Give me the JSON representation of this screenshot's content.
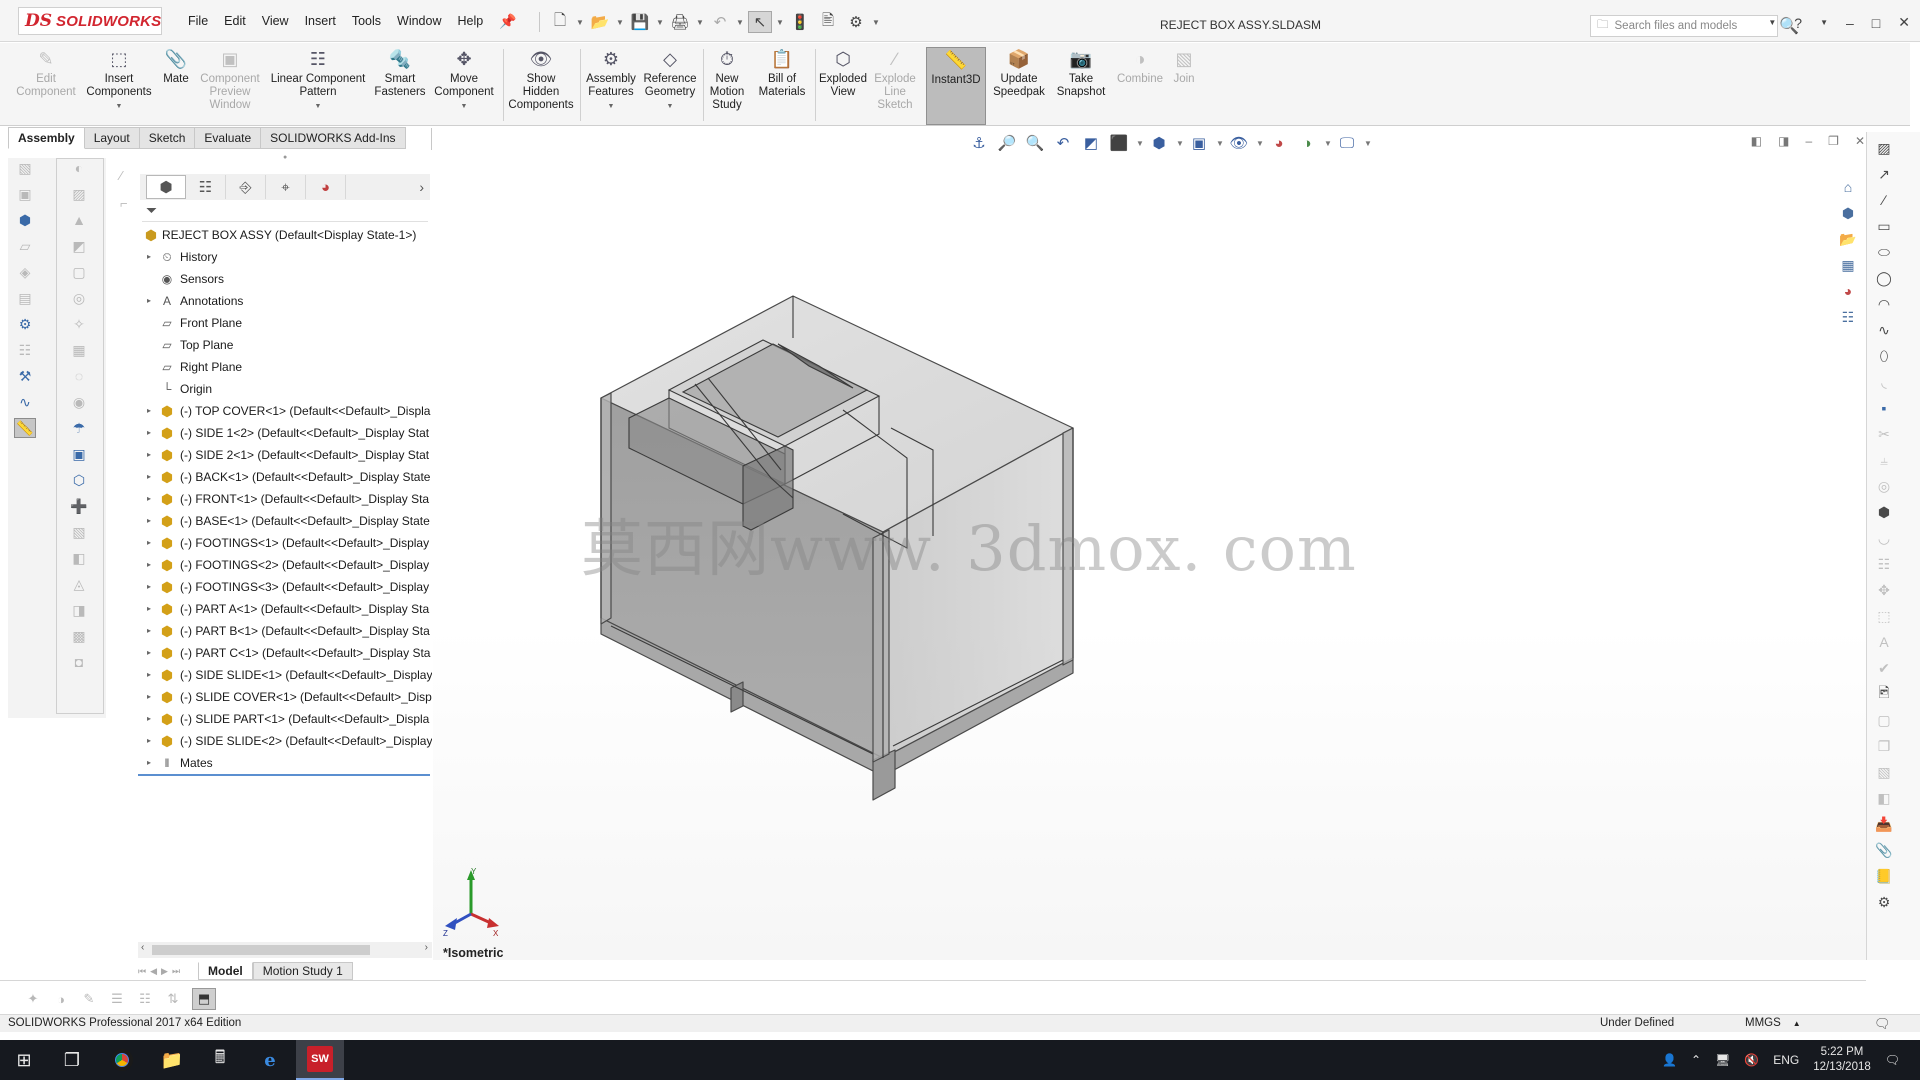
{
  "app": {
    "logo_ds": "DS",
    "logo_name": "SOLIDWORKS",
    "document_title": "REJECT BOX ASSY.SLDASM"
  },
  "menus": [
    "File",
    "Edit",
    "View",
    "Insert",
    "Tools",
    "Window",
    "Help"
  ],
  "search": {
    "placeholder": "Search files and models"
  },
  "commands": [
    {
      "l1": "Edit",
      "l2": "Component",
      "l3": "",
      "icon": "edit-component-icon",
      "enabled": false,
      "arrow": false
    },
    {
      "l1": "Insert",
      "l2": "Components",
      "l3": "",
      "icon": "insert-components-icon",
      "enabled": true,
      "arrow": true
    },
    {
      "l1": "Mate",
      "l2": "",
      "l3": "",
      "icon": "mate-icon",
      "enabled": true,
      "arrow": false
    },
    {
      "l1": "Component",
      "l2": "Preview",
      "l3": "Window",
      "icon": "component-preview-icon",
      "enabled": false,
      "arrow": false
    },
    {
      "l1": "Linear Component",
      "l2": "Pattern",
      "l3": "",
      "icon": "linear-pattern-icon",
      "enabled": true,
      "arrow": true
    },
    {
      "l1": "Smart",
      "l2": "Fasteners",
      "l3": "",
      "icon": "smart-fasteners-icon",
      "enabled": true,
      "arrow": false
    },
    {
      "l1": "Move",
      "l2": "Component",
      "l3": "",
      "icon": "move-component-icon",
      "enabled": true,
      "arrow": true
    },
    {
      "l1": "Show",
      "l2": "Hidden",
      "l3": "Components",
      "icon": "show-hidden-icon",
      "enabled": true,
      "arrow": false
    },
    {
      "l1": "Assembly",
      "l2": "Features",
      "l3": "",
      "icon": "assembly-features-icon",
      "enabled": true,
      "arrow": true
    },
    {
      "l1": "Reference",
      "l2": "Geometry",
      "l3": "",
      "icon": "reference-geometry-icon",
      "enabled": true,
      "arrow": true
    },
    {
      "l1": "New",
      "l2": "Motion",
      "l3": "Study",
      "icon": "motion-study-icon",
      "enabled": true,
      "arrow": false
    },
    {
      "l1": "Bill of",
      "l2": "Materials",
      "l3": "",
      "icon": "bom-icon",
      "enabled": true,
      "arrow": false
    },
    {
      "l1": "Exploded",
      "l2": "View",
      "l3": "",
      "icon": "exploded-view-icon",
      "enabled": true,
      "arrow": false
    },
    {
      "l1": "Explode",
      "l2": "Line",
      "l3": "Sketch",
      "icon": "explode-line-icon",
      "enabled": false,
      "arrow": false
    },
    {
      "l1": "Instant3D",
      "l2": "",
      "l3": "",
      "icon": "instant3d-icon",
      "enabled": true,
      "arrow": false,
      "active": true
    },
    {
      "l1": "Update",
      "l2": "Speedpak",
      "l3": "",
      "icon": "speedpak-icon",
      "enabled": true,
      "arrow": false
    },
    {
      "l1": "Take",
      "l2": "Snapshot",
      "l3": "",
      "icon": "snapshot-icon",
      "enabled": true,
      "arrow": false
    },
    {
      "l1": "Combine",
      "l2": "",
      "l3": "",
      "icon": "combine-icon",
      "enabled": false,
      "arrow": false
    },
    {
      "l1": "Join",
      "l2": "",
      "l3": "",
      "icon": "join-icon",
      "enabled": false,
      "arrow": false
    }
  ],
  "tabs": [
    "Assembly",
    "Layout",
    "Sketch",
    "Evaluate",
    "SOLIDWORKS Add-Ins"
  ],
  "active_tab": "Assembly",
  "tree": {
    "root": "REJECT BOX ASSY  (Default<Display State-1>)",
    "items": [
      {
        "label": "History",
        "icon": "history-icon",
        "expand": true
      },
      {
        "label": "Sensors",
        "icon": "sensors-icon",
        "expand": false
      },
      {
        "label": "Annotations",
        "icon": "annotations-icon",
        "expand": true
      },
      {
        "label": "Front Plane",
        "icon": "plane-icon",
        "expand": false
      },
      {
        "label": "Top Plane",
        "icon": "plane-icon",
        "expand": false
      },
      {
        "label": "Right Plane",
        "icon": "plane-icon",
        "expand": false
      },
      {
        "label": "Origin",
        "icon": "origin-icon",
        "expand": false
      },
      {
        "label": "(-) TOP COVER<1> (Default<<Default>_Displa",
        "icon": "part-icon",
        "expand": true
      },
      {
        "label": "(-) SIDE 1<2> (Default<<Default>_Display Stat",
        "icon": "part-icon",
        "expand": true
      },
      {
        "label": "(-) SIDE 2<1> (Default<<Default>_Display Stat",
        "icon": "part-icon",
        "expand": true
      },
      {
        "label": "(-) BACK<1> (Default<<Default>_Display State",
        "icon": "part-icon",
        "expand": true
      },
      {
        "label": "(-) FRONT<1> (Default<<Default>_Display Sta",
        "icon": "part-icon",
        "expand": true
      },
      {
        "label": "(-) BASE<1> (Default<<Default>_Display State",
        "icon": "part-icon",
        "expand": true
      },
      {
        "label": "(-) FOOTINGS<1> (Default<<Default>_Display",
        "icon": "part-icon",
        "expand": true
      },
      {
        "label": "(-) FOOTINGS<2> (Default<<Default>_Display",
        "icon": "part-icon",
        "expand": true
      },
      {
        "label": "(-) FOOTINGS<3> (Default<<Default>_Display",
        "icon": "part-icon",
        "expand": true
      },
      {
        "label": "(-) PART A<1> (Default<<Default>_Display Sta",
        "icon": "part-icon",
        "expand": true
      },
      {
        "label": "(-) PART B<1> (Default<<Default>_Display Sta",
        "icon": "part-icon",
        "expand": true
      },
      {
        "label": "(-) PART C<1> (Default<<Default>_Display Sta",
        "icon": "part-icon",
        "expand": true
      },
      {
        "label": "(-) SIDE SLIDE<1> (Default<<Default>_Display",
        "icon": "part-icon",
        "expand": true
      },
      {
        "label": "(-) SLIDE COVER<1> (Default<<Default>_Disp",
        "icon": "part-icon",
        "expand": true
      },
      {
        "label": "(-) SLIDE PART<1> (Default<<Default>_Displa",
        "icon": "part-icon",
        "expand": true
      },
      {
        "label": "(-) SIDE SLIDE<2> (Default<<Default>_Display",
        "icon": "part-icon",
        "expand": true
      },
      {
        "label": "Mates",
        "icon": "mates-icon",
        "expand": true
      }
    ]
  },
  "viewport": {
    "watermark": "莫西网www. 3dmox. com",
    "view_label": "*Isometric"
  },
  "bottom_tabs": [
    "Model",
    "Motion Study 1"
  ],
  "status": {
    "edition": "SOLIDWORKS Professional 2017 x64 Edition",
    "state": "Under Defined",
    "units": "MMGS"
  },
  "taskbar": {
    "language": "ENG",
    "time": "5:22 PM",
    "date": "12/13/2018",
    "sw_label": "SW"
  }
}
